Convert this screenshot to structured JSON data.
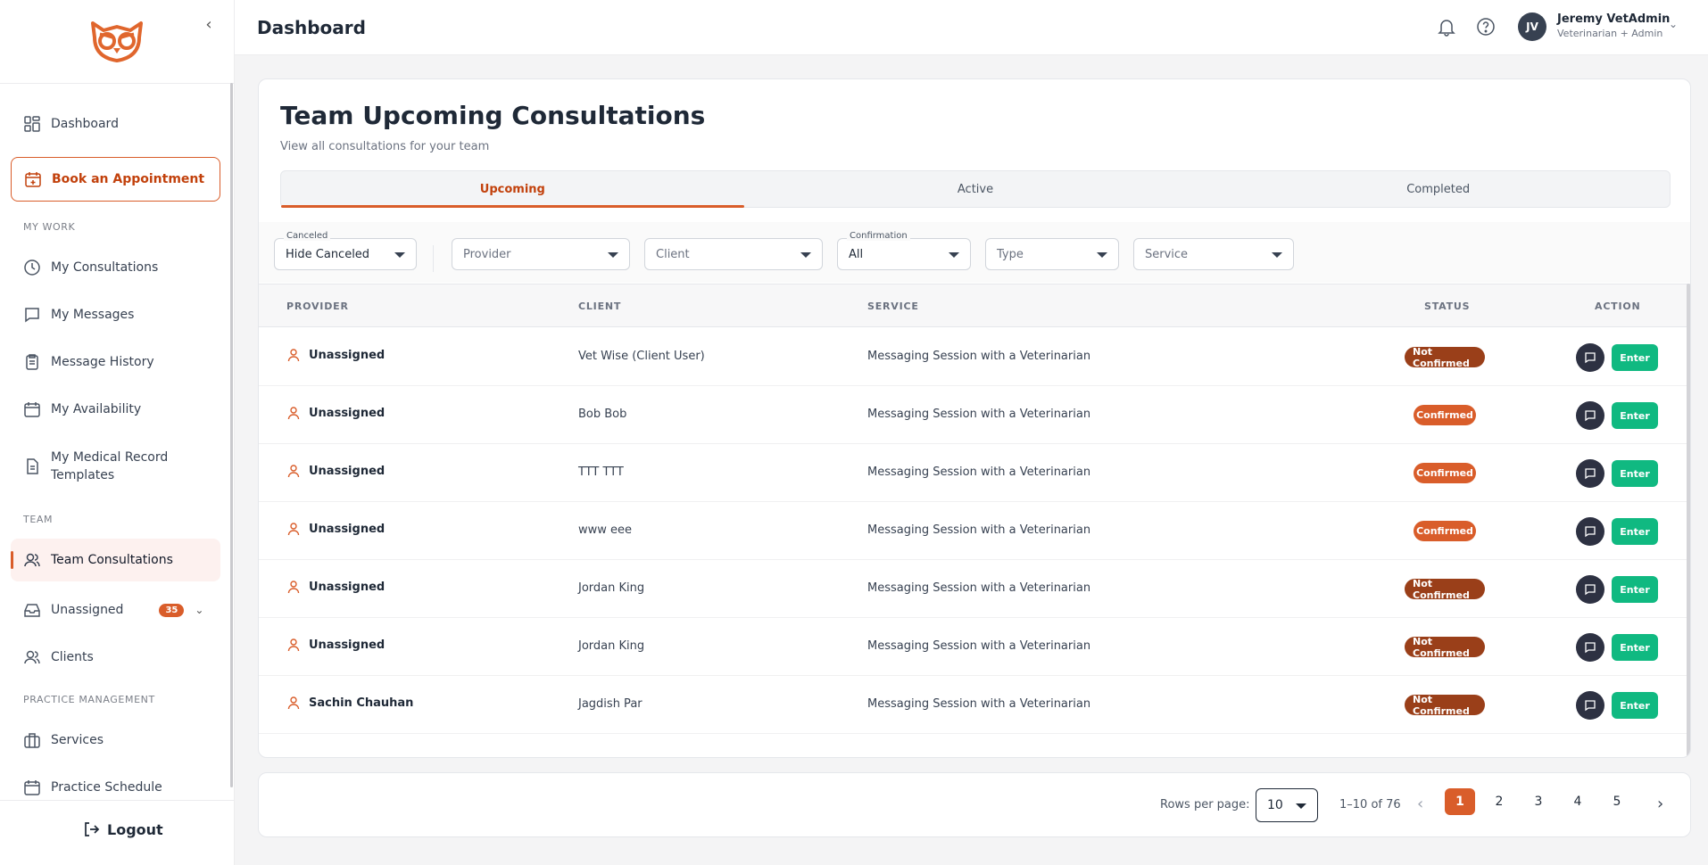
{
  "colors": {
    "accent": "#d95d2a",
    "confirmed": "#d95d2a",
    "not_confirmed": "#9a3f19",
    "enter": "#10b981"
  },
  "sidebar": {
    "book_label": "Book an Appointment",
    "sections": {
      "my_work": "MY WORK",
      "team": "TEAM",
      "practice": "PRACTICE MANAGEMENT"
    },
    "items": {
      "dashboard": "Dashboard",
      "my_consultations": "My Consultations",
      "my_messages": "My Messages",
      "message_history": "Message History",
      "my_availability": "My Availability",
      "medical_templates": "My Medical Record Templates",
      "team_consultations": "Team Consultations",
      "unassigned": "Unassigned",
      "unassigned_count": "35",
      "clients": "Clients",
      "services": "Services",
      "practice_schedule": "Practice Schedule"
    },
    "logout": "Logout"
  },
  "header": {
    "title": "Dashboard",
    "user": {
      "initials": "JV",
      "name": "Jeremy VetAdmin",
      "role": "Veterinarian + Admin"
    }
  },
  "main": {
    "title": "Team Upcoming Consultations",
    "subtitle": "View all consultations for your team",
    "tabs": [
      "Upcoming",
      "Active",
      "Completed"
    ],
    "active_tab": "Upcoming",
    "filters": {
      "canceled": {
        "label": "Canceled",
        "value": "Hide Canceled"
      },
      "provider": {
        "placeholder": "Provider"
      },
      "client": {
        "placeholder": "Client"
      },
      "confirmation": {
        "label": "Confirmation",
        "value": "All"
      },
      "type": {
        "placeholder": "Type"
      },
      "service": {
        "placeholder": "Service"
      }
    },
    "columns": {
      "provider": "PROVIDER",
      "client": "CLIENT",
      "service": "SERVICE",
      "status": "STATUS",
      "action": "ACTION"
    },
    "enter_label": "Enter",
    "rows": [
      {
        "provider": "Unassigned",
        "client": "Vet Wise (Client User)",
        "service": "Messaging Session with a Veterinarian",
        "status": "Not Confirmed"
      },
      {
        "provider": "Unassigned",
        "client": "Bob Bob",
        "service": "Messaging Session with a Veterinarian",
        "status": "Confirmed"
      },
      {
        "provider": "Unassigned",
        "client": "TTT TTT",
        "service": "Messaging Session with a Veterinarian",
        "status": "Confirmed"
      },
      {
        "provider": "Unassigned",
        "client": "www eee",
        "service": "Messaging Session with a Veterinarian",
        "status": "Confirmed"
      },
      {
        "provider": "Unassigned",
        "client": "Jordan King",
        "service": "Messaging Session with a Veterinarian",
        "status": "Not Confirmed"
      },
      {
        "provider": "Unassigned",
        "client": "Jordan King",
        "service": "Messaging Session with a Veterinarian",
        "status": "Not Confirmed"
      },
      {
        "provider": "Sachin Chauhan",
        "client": "Jagdish Par",
        "service": "Messaging Session with a Veterinarian",
        "status": "Not Confirmed"
      }
    ]
  },
  "pagination": {
    "rows_label": "Rows per page:",
    "rows_value": "10",
    "range": "1–10 of 76",
    "pages": [
      "1",
      "2",
      "3",
      "4",
      "5"
    ],
    "current": "1"
  }
}
